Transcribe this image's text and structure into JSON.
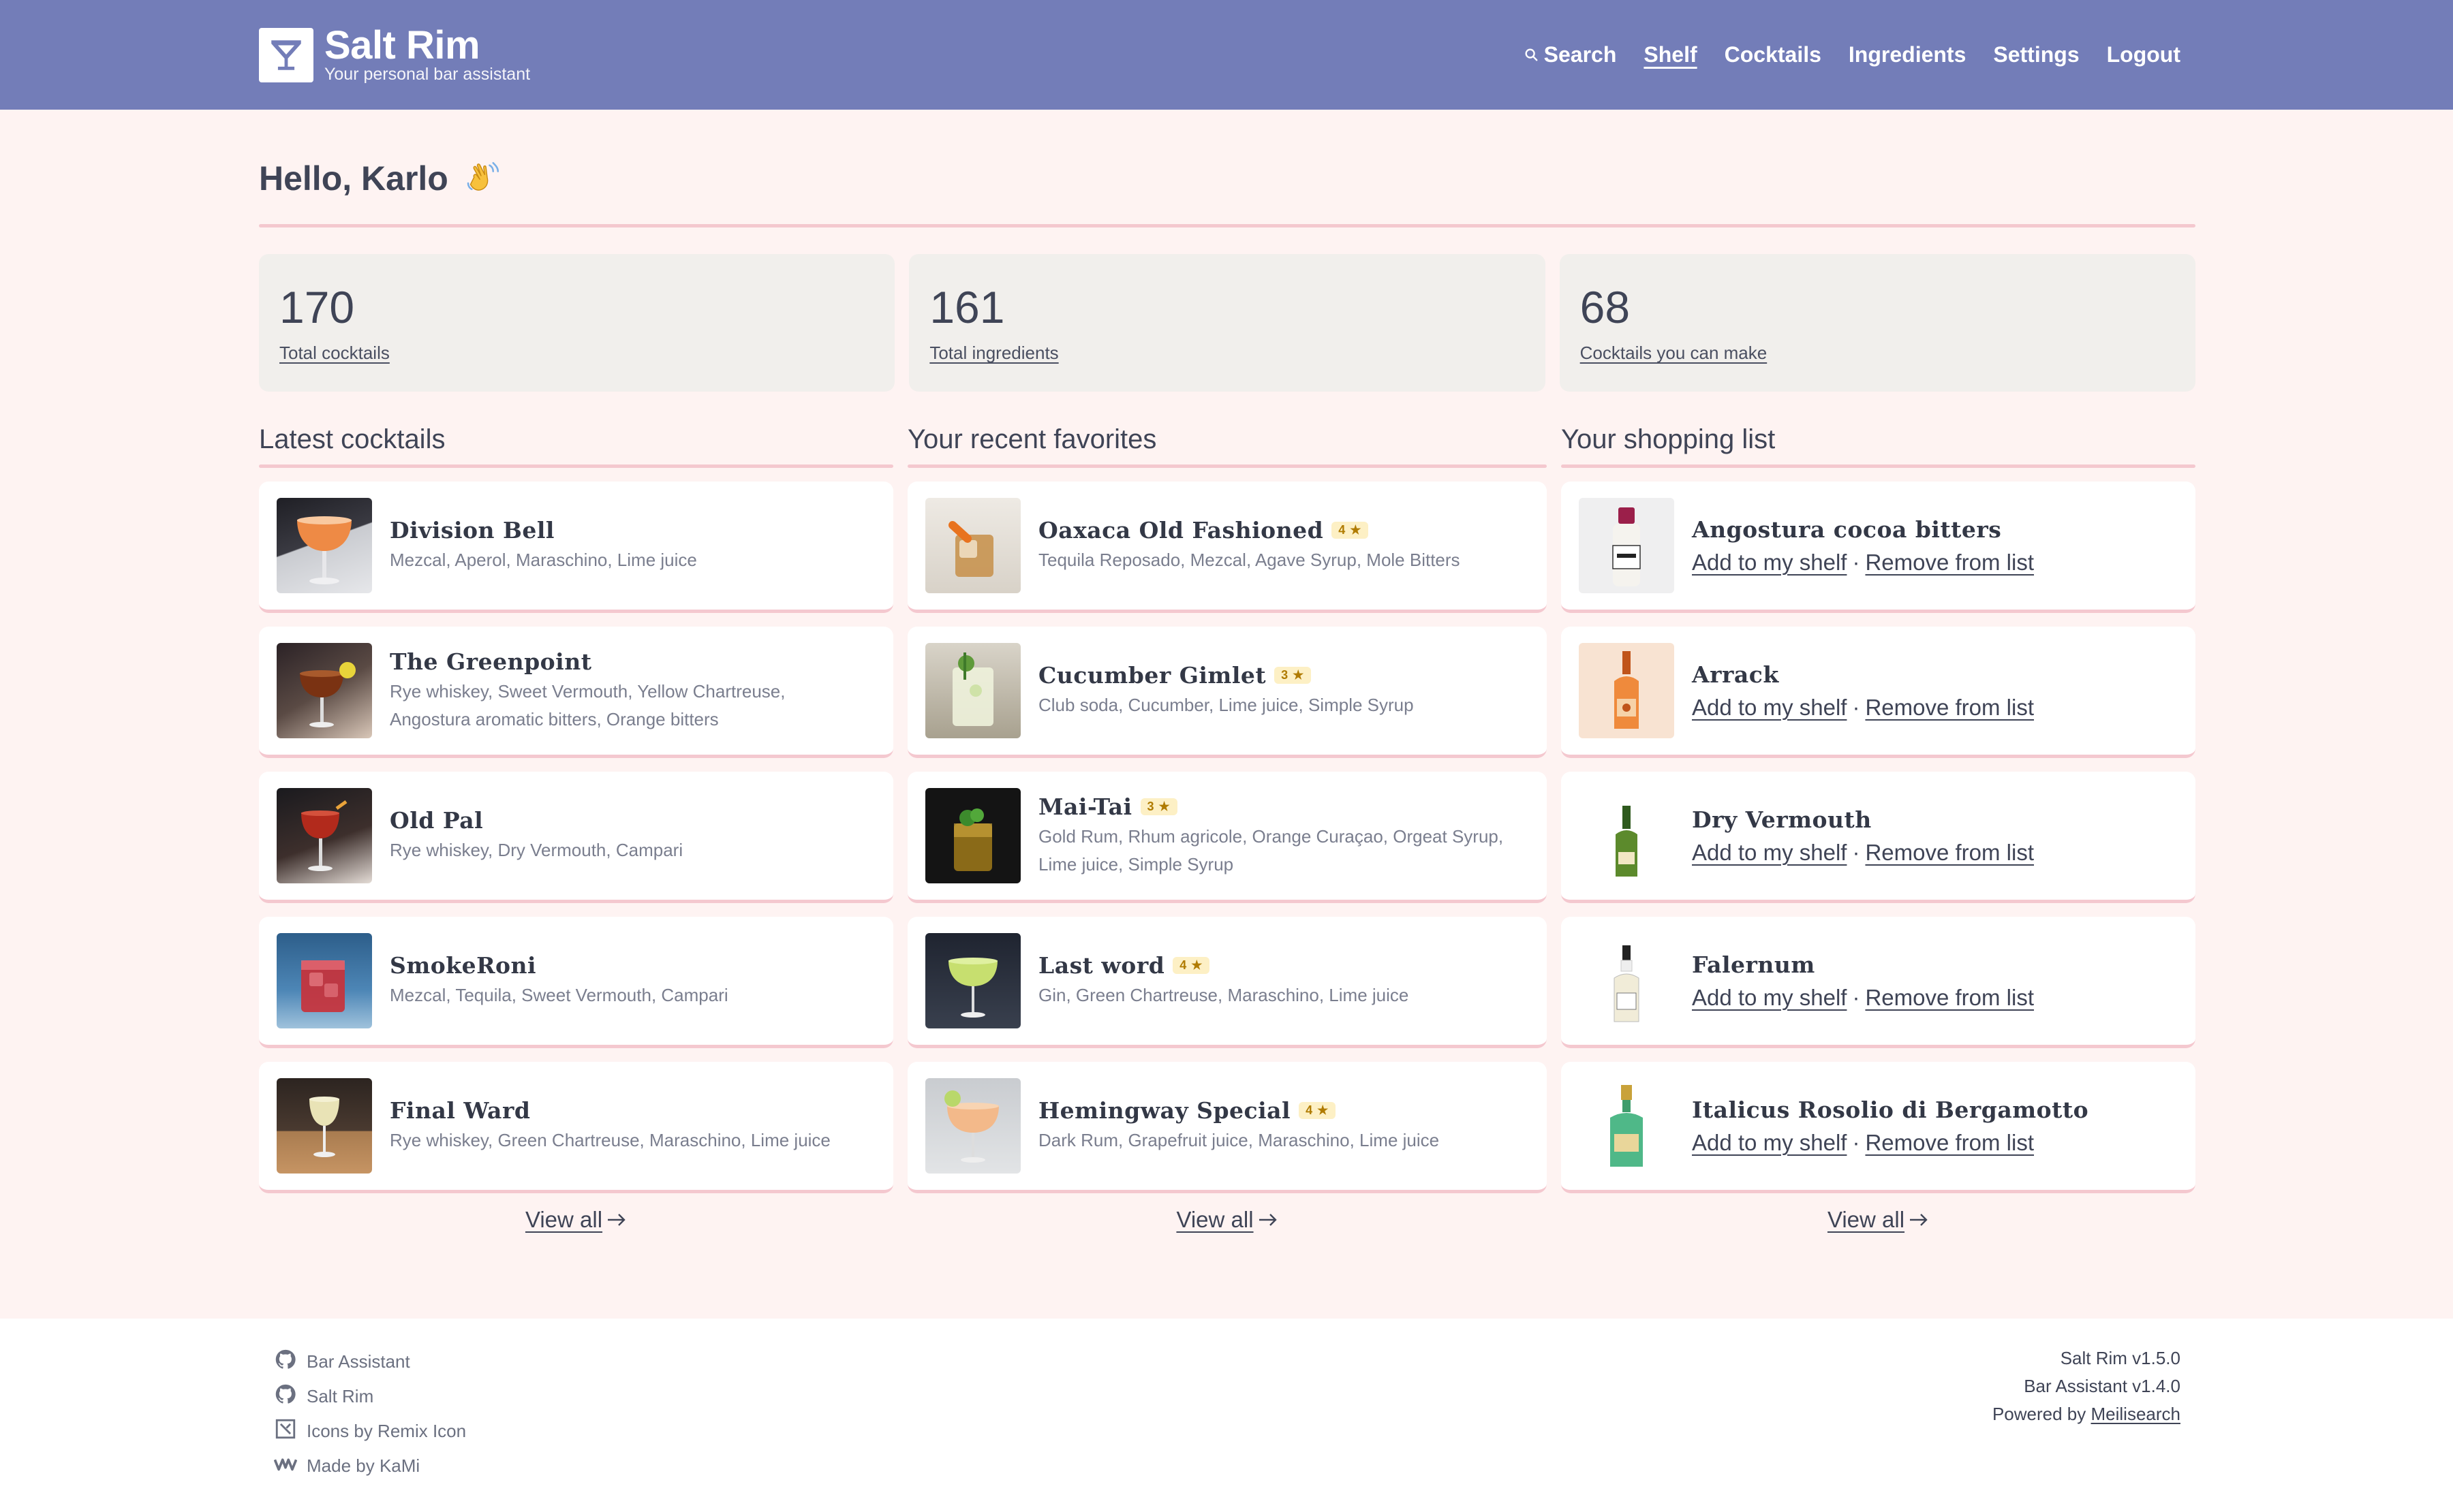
{
  "app": {
    "title": "Salt Rim",
    "subtitle": "Your personal bar assistant"
  },
  "nav": {
    "search": "Search",
    "shelf": "Shelf",
    "cocktails": "Cocktails",
    "ingredients": "Ingredients",
    "settings": "Settings",
    "logout": "Logout"
  },
  "greeting": "Hello, Karlo",
  "stats": [
    {
      "value": "170",
      "label": "Total cocktails"
    },
    {
      "value": "161",
      "label": "Total ingredients"
    },
    {
      "value": "68",
      "label": "Cocktails you can make"
    }
  ],
  "latest": {
    "title": "Latest cocktails",
    "items": [
      {
        "name": "Division Bell",
        "ingredients": "Mezcal, Aperol, Maraschino, Lime juice"
      },
      {
        "name": "The Greenpoint",
        "ingredients": "Rye whiskey, Sweet Vermouth, Yellow Chartreuse, Angostura aromatic bitters, Orange bitters"
      },
      {
        "name": "Old Pal",
        "ingredients": "Rye whiskey, Dry Vermouth, Campari"
      },
      {
        "name": "SmokeRoni",
        "ingredients": "Mezcal, Tequila, Sweet Vermouth, Campari"
      },
      {
        "name": "Final Ward",
        "ingredients": "Rye whiskey, Green Chartreuse, Maraschino, Lime juice"
      }
    ],
    "view_all": "View all"
  },
  "favorites": {
    "title": "Your recent favorites",
    "items": [
      {
        "name": "Oaxaca Old Fashioned",
        "rating": "4 ★",
        "ingredients": "Tequila Reposado, Mezcal, Agave Syrup, Mole Bitters"
      },
      {
        "name": "Cucumber Gimlet",
        "rating": "3 ★",
        "ingredients": "Club soda, Cucumber, Lime juice, Simple Syrup"
      },
      {
        "name": "Mai-Tai",
        "rating": "3 ★",
        "ingredients": "Gold Rum, Rhum agricole, Orange Curaçao, Orgeat Syrup, Lime juice, Simple Syrup"
      },
      {
        "name": "Last word",
        "rating": "4 ★",
        "ingredients": "Gin, Green Chartreuse, Maraschino, Lime juice"
      },
      {
        "name": "Hemingway Special",
        "rating": "4 ★",
        "ingredients": "Dark Rum, Grapefruit juice, Maraschino, Lime juice"
      }
    ],
    "view_all": "View all"
  },
  "shopping": {
    "title": "Your shopping list",
    "add_label": "Add to my shelf",
    "remove_label": "Remove from list",
    "separator": "·",
    "items": [
      {
        "name": "Angostura cocoa bitters"
      },
      {
        "name": "Arrack"
      },
      {
        "name": "Dry Vermouth"
      },
      {
        "name": "Falernum"
      },
      {
        "name": "Italicus Rosolio di Bergamotto"
      }
    ],
    "view_all": "View all"
  },
  "footer": {
    "links": [
      "Bar Assistant",
      "Salt Rim",
      "Icons by Remix Icon",
      "Made by KaMi"
    ],
    "salt_rim_version": "Salt Rim v1.5.0",
    "bar_assistant_version": "Bar Assistant v1.4.0",
    "powered_by": "Powered by",
    "powered_by_link": "Meilisearch"
  },
  "colors": {
    "header": "#737db8",
    "background": "#fef3f2",
    "accent_border": "#f4c8cf",
    "stat_bg": "#f1efec"
  },
  "icons": [
    "martini-glass-icon",
    "search-icon",
    "waving-hand-icon",
    "arrow-right-icon",
    "github-icon",
    "remix-icon",
    "kami-icon"
  ]
}
